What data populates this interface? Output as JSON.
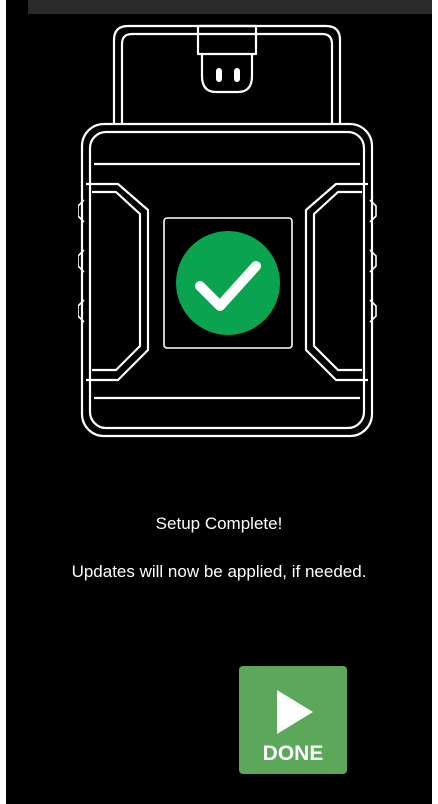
{
  "status": {
    "title": "Setup Complete!",
    "message": "Updates will now be applied, if needed."
  },
  "done_button": {
    "label": "DONE"
  },
  "colors": {
    "background": "#000000",
    "success_green": "#0aa34f",
    "button_green": "#5ba85a",
    "outline": "#ffffff"
  },
  "icons": {
    "device": "obd-adapter-illustration",
    "status": "check-circle-icon",
    "button": "play-icon"
  }
}
